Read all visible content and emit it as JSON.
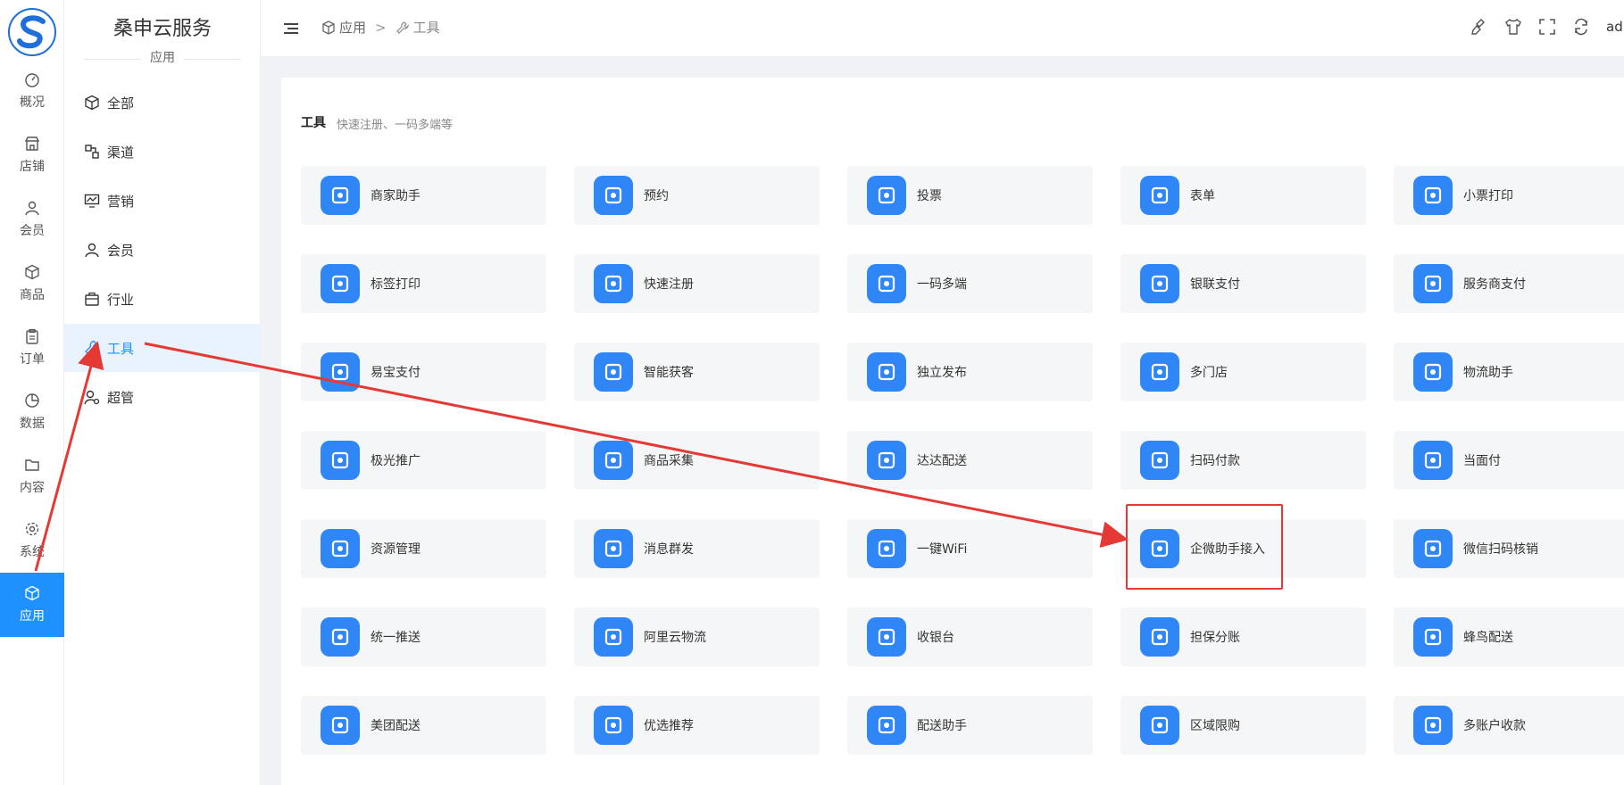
{
  "rail": {
    "items": [
      {
        "label": "概况",
        "icon": "dashboard-icon"
      },
      {
        "label": "店铺",
        "icon": "store-icon"
      },
      {
        "label": "会员",
        "icon": "user-icon"
      },
      {
        "label": "商品",
        "icon": "cube-icon"
      },
      {
        "label": "订单",
        "icon": "clipboard-icon"
      },
      {
        "label": "数据",
        "icon": "pie-chart-icon"
      },
      {
        "label": "内容",
        "icon": "folder-icon"
      },
      {
        "label": "系统",
        "icon": "gear-icon"
      },
      {
        "label": "应用",
        "icon": "cube-icon"
      }
    ],
    "active_index": 8
  },
  "sub": {
    "brand": "桑申云服务",
    "subtitle": "应用",
    "items": [
      {
        "label": "全部",
        "icon": "cube-icon"
      },
      {
        "label": "渠道",
        "icon": "channel-icon"
      },
      {
        "label": "营销",
        "icon": "monitor-chart-icon"
      },
      {
        "label": "会员",
        "icon": "user-icon"
      },
      {
        "label": "行业",
        "icon": "briefcase-icon"
      },
      {
        "label": "工具",
        "icon": "wrench-icon"
      },
      {
        "label": "超管",
        "icon": "admin-icon"
      }
    ],
    "active_index": 5
  },
  "header": {
    "crumb_root": "应用",
    "crumb_sep": ">",
    "crumb_current": "工具",
    "user": "ad"
  },
  "section": {
    "title": "工具",
    "desc": "快速注册、一码多端等"
  },
  "tiles": [
    [
      "商家助手",
      "预约",
      "投票",
      "表单",
      "小票打印"
    ],
    [
      "标签打印",
      "快速注册",
      "一码多端",
      "银联支付",
      "服务商支付"
    ],
    [
      "易宝支付",
      "智能获客",
      "独立发布",
      "多门店",
      "物流助手"
    ],
    [
      "极光推广",
      "商品采集",
      "达达配送",
      "扫码付款",
      "当面付"
    ],
    [
      "资源管理",
      "消息群发",
      "一键WiFi",
      "企微助手接入",
      "微信扫码核销"
    ],
    [
      "统一推送",
      "阿里云物流",
      "收银台",
      "担保分账",
      "蜂鸟配送"
    ],
    [
      "美团配送",
      "优选推荐",
      "配送助手",
      "区域限购",
      "多账户收款"
    ]
  ],
  "colors": {
    "accent": "#1e90ff",
    "tile_icon": "#2f87f7",
    "annotation": "#e53935"
  }
}
